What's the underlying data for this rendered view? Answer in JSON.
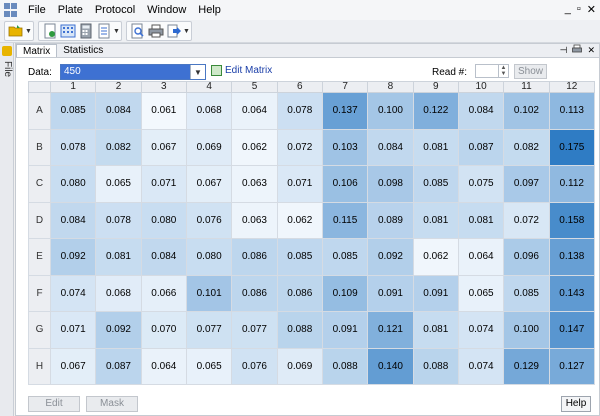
{
  "menubar": {
    "items": [
      "File",
      "Plate",
      "Protocol",
      "Window",
      "Help"
    ],
    "window_controls": [
      "_",
      "▫",
      "✕"
    ]
  },
  "sidebar": {
    "label": "File"
  },
  "tabs": [
    "Matrix",
    "Statistics"
  ],
  "panel_controls": [
    "⊣",
    "✕"
  ],
  "controls": {
    "data_label": "Data:",
    "data_value": "450",
    "edit_matrix_label": "Edit Matrix",
    "read_label": "Read #:",
    "show_label": "Show"
  },
  "grid": {
    "columns": [
      "1",
      "2",
      "3",
      "4",
      "5",
      "6",
      "7",
      "8",
      "9",
      "10",
      "11",
      "12"
    ],
    "rows": [
      {
        "label": "A",
        "values": [
          "0.085",
          "0.084",
          "0.061",
          "0.068",
          "0.064",
          "0.078",
          "0.137",
          "0.100",
          "0.122",
          "0.084",
          "0.102",
          "0.113"
        ]
      },
      {
        "label": "B",
        "values": [
          "0.078",
          "0.082",
          "0.067",
          "0.069",
          "0.062",
          "0.072",
          "0.103",
          "0.084",
          "0.081",
          "0.087",
          "0.082",
          "0.175"
        ]
      },
      {
        "label": "C",
        "values": [
          "0.080",
          "0.065",
          "0.071",
          "0.067",
          "0.063",
          "0.071",
          "0.106",
          "0.098",
          "0.085",
          "0.075",
          "0.097",
          "0.112"
        ]
      },
      {
        "label": "D",
        "values": [
          "0.084",
          "0.078",
          "0.080",
          "0.076",
          "0.063",
          "0.062",
          "0.115",
          "0.089",
          "0.081",
          "0.081",
          "0.072",
          "0.158"
        ]
      },
      {
        "label": "E",
        "values": [
          "0.092",
          "0.081",
          "0.084",
          "0.080",
          "0.086",
          "0.085",
          "0.085",
          "0.092",
          "0.062",
          "0.064",
          "0.096",
          "0.138"
        ]
      },
      {
        "label": "F",
        "values": [
          "0.074",
          "0.068",
          "0.066",
          "0.101",
          "0.086",
          "0.086",
          "0.109",
          "0.091",
          "0.091",
          "0.065",
          "0.085",
          "0.143"
        ]
      },
      {
        "label": "G",
        "values": [
          "0.071",
          "0.092",
          "0.070",
          "0.077",
          "0.077",
          "0.088",
          "0.091",
          "0.121",
          "0.081",
          "0.074",
          "0.100",
          "0.147"
        ]
      },
      {
        "label": "H",
        "values": [
          "0.067",
          "0.087",
          "0.064",
          "0.065",
          "0.076",
          "0.069",
          "0.088",
          "0.140",
          "0.088",
          "0.074",
          "0.129",
          "0.127"
        ]
      }
    ]
  },
  "colors": {
    "heat_low": "#f3f8fd",
    "heat_high": "#2f7cc4",
    "selection": "#3e71d2"
  },
  "bottom": {
    "edit_label": "Edit",
    "mask_label": "Mask",
    "help_label": "Help"
  }
}
